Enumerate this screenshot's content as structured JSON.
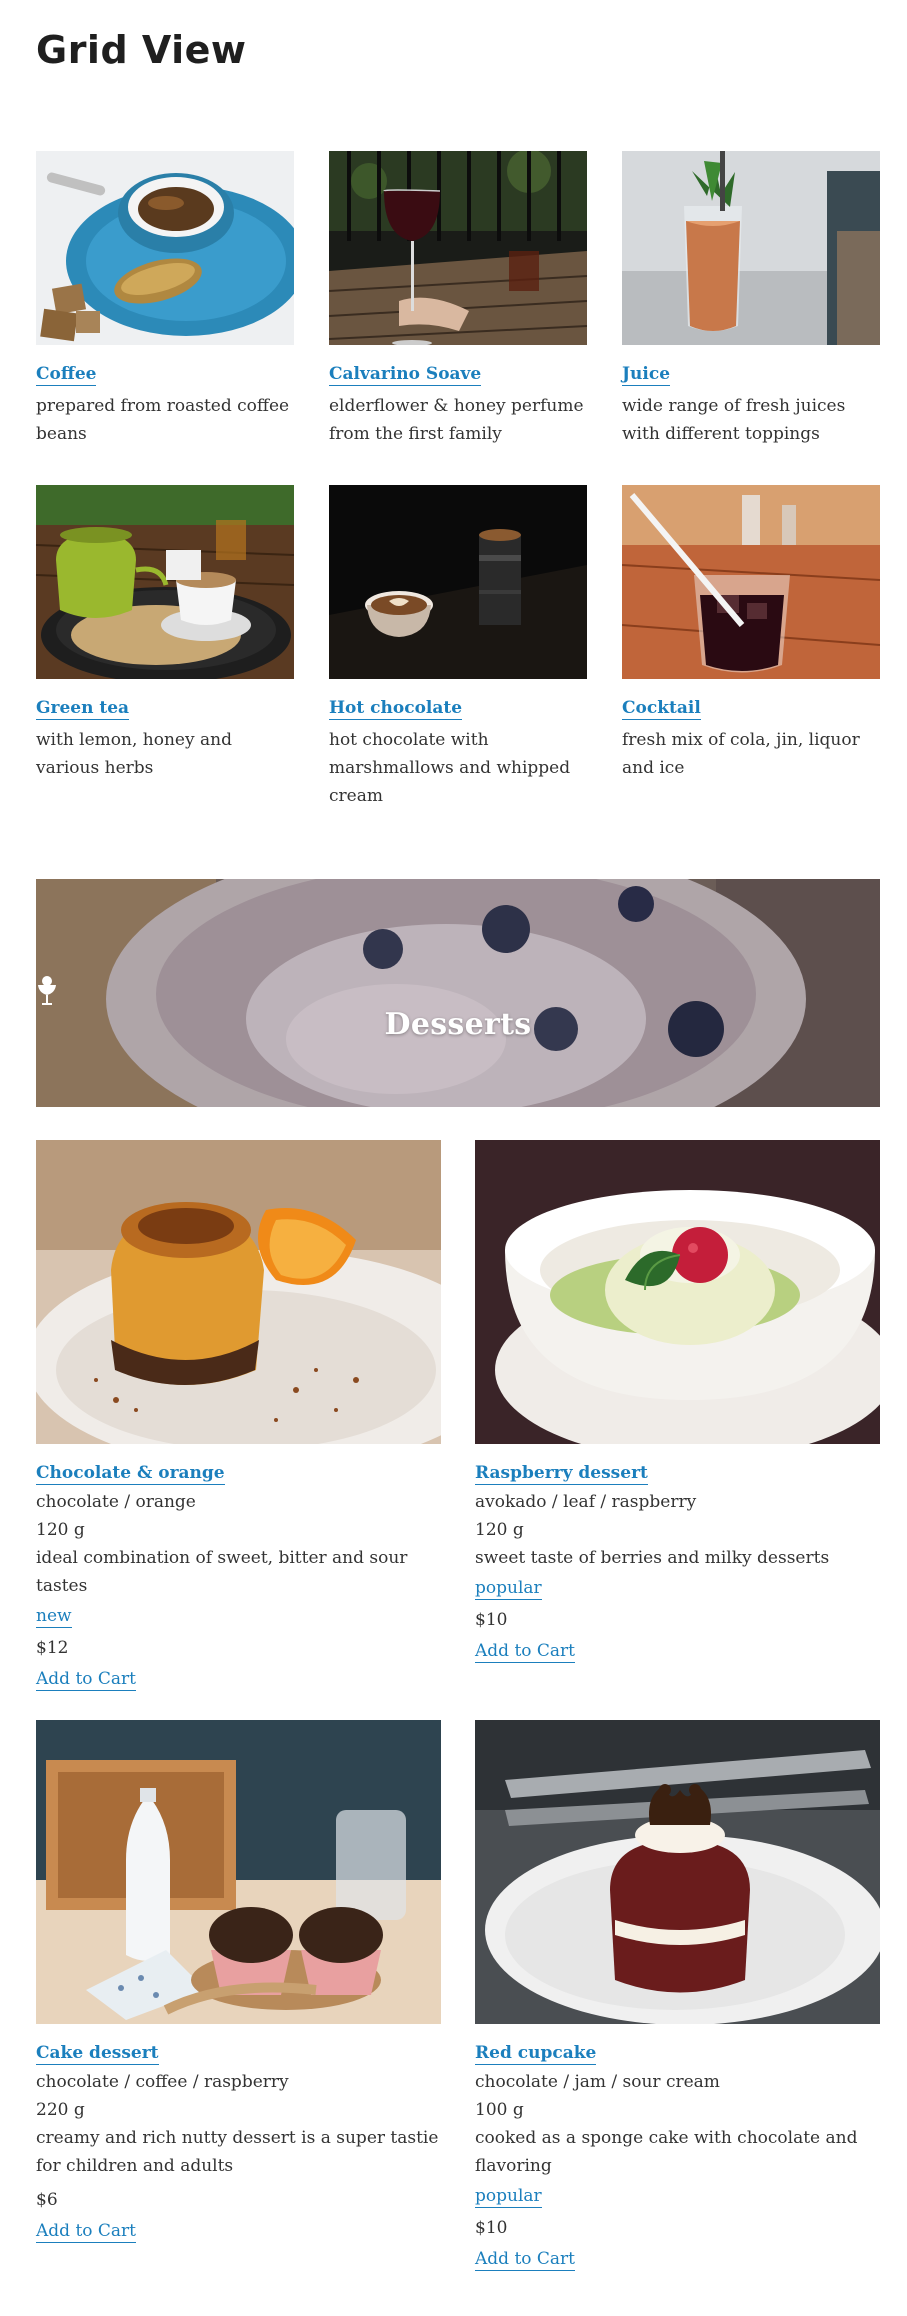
{
  "page": {
    "title": "Grid View"
  },
  "drinks": [
    {
      "title": "Coffee",
      "description": "prepared from roasted coffee beans",
      "image": "coffee-photo"
    },
    {
      "title": "Calvarino Soave",
      "description": "elderflower & honey perfume from the first family",
      "image": "wine-photo"
    },
    {
      "title": "Juice",
      "description": "wide range of fresh juices with different toppings",
      "image": "juice-photo"
    },
    {
      "title": "Green tea",
      "description": "with lemon, honey and various herbs",
      "image": "green-tea-photo"
    },
    {
      "title": "Hot chocolate",
      "description": "hot chocolate with marshmallows and whipped cream",
      "image": "hot-chocolate-photo"
    },
    {
      "title": "Cocktail",
      "description": "fresh mix of cola, jin, liquor and ice",
      "image": "cocktail-photo"
    }
  ],
  "banner": {
    "label": "Desserts",
    "icon": "ice-cream-icon"
  },
  "desserts": [
    {
      "title": "Chocolate & orange",
      "ingredients": "chocolate / orange",
      "weight": "120 g",
      "description": "ideal combination of sweet, bitter and sour tastes",
      "tag": "new",
      "price": "$12",
      "cart_label": "Add to Cart"
    },
    {
      "title": "Raspberry dessert",
      "ingredients": "avokado / leaf / raspberry",
      "weight": "120 g",
      "description": "sweet taste of berries and milky desserts",
      "tag": "popular",
      "price": "$10",
      "cart_label": "Add to Cart"
    },
    {
      "title": "Cake dessert",
      "ingredients": "chocolate / coffee / raspberry",
      "weight": "220 g",
      "description": "creamy and rich nutty dessert is a super tastie for children and adults",
      "tag": "",
      "price": "$6",
      "cart_label": "Add to Cart"
    },
    {
      "title": "Red cupcake",
      "ingredients": "chocolate / jam / sour cream",
      "weight": "100 g",
      "description": "cooked as a sponge cake with chocolate and flavoring",
      "tag": "popular",
      "price": "$10",
      "cart_label": "Add to Cart"
    }
  ],
  "colors": {
    "link": "#1b7fbd",
    "text": "#333333",
    "heading": "#1f1f1f"
  }
}
